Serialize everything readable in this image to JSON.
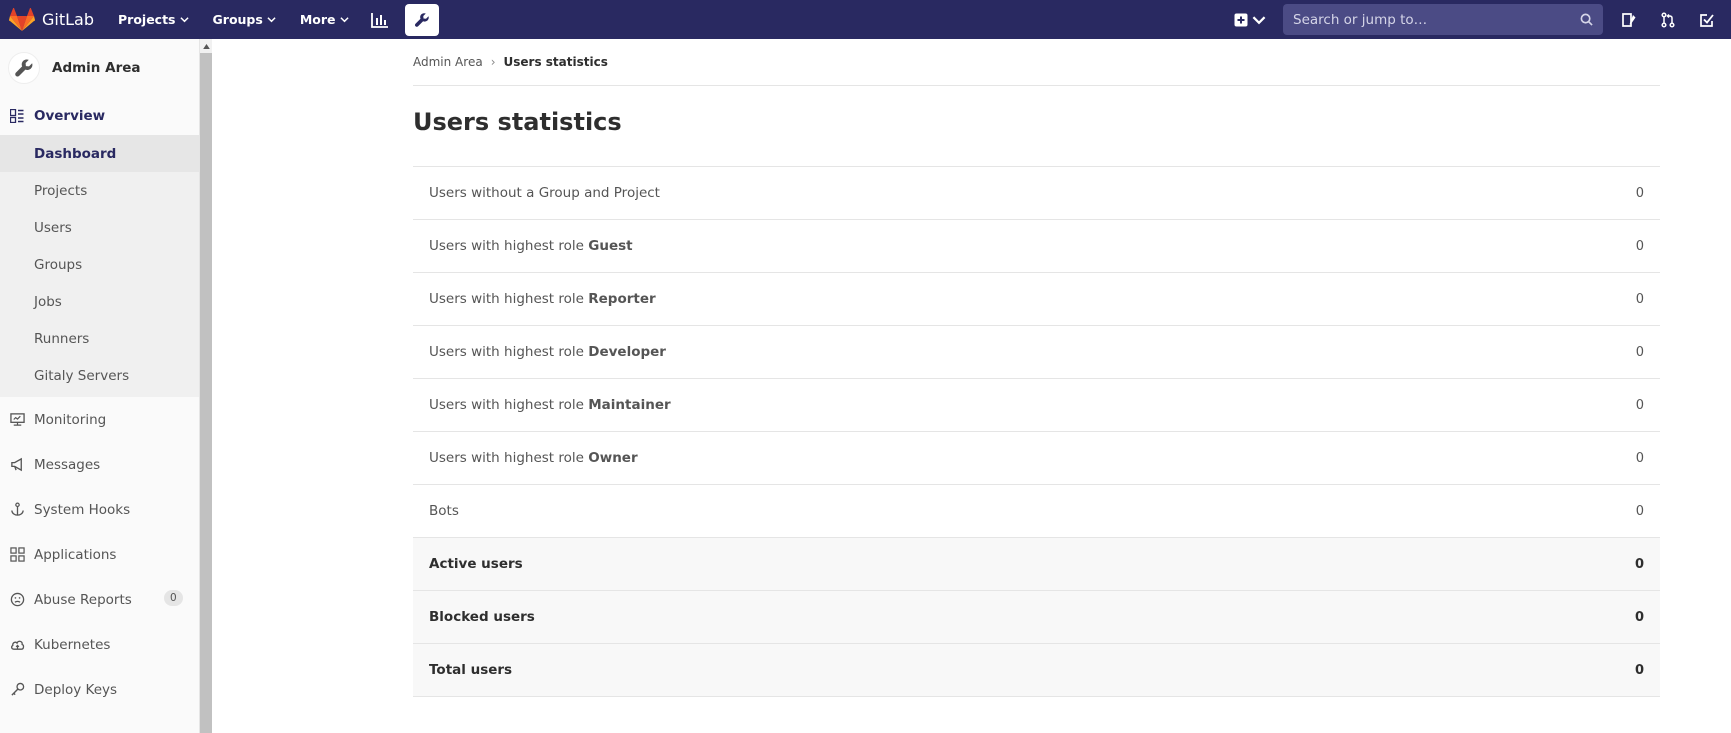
{
  "navbar": {
    "logo_text": "GitLab",
    "menu": [
      {
        "label": "Projects"
      },
      {
        "label": "Groups"
      },
      {
        "label": "More"
      }
    ],
    "search_placeholder": "Search or jump to…",
    "brand_color": "#292961"
  },
  "sidebar": {
    "title": "Admin Area",
    "overview": {
      "label": "Overview",
      "items": [
        {
          "label": "Dashboard",
          "active": true
        },
        {
          "label": "Projects"
        },
        {
          "label": "Users"
        },
        {
          "label": "Groups"
        },
        {
          "label": "Jobs"
        },
        {
          "label": "Runners"
        },
        {
          "label": "Gitaly Servers"
        }
      ]
    },
    "items": [
      {
        "label": "Monitoring",
        "icon": "monitor-icon"
      },
      {
        "label": "Messages",
        "icon": "megaphone-icon"
      },
      {
        "label": "System Hooks",
        "icon": "anchor-icon"
      },
      {
        "label": "Applications",
        "icon": "applications-icon"
      },
      {
        "label": "Abuse Reports",
        "icon": "frown-icon",
        "badge": "0"
      },
      {
        "label": "Kubernetes",
        "icon": "cloud-icon"
      },
      {
        "label": "Deploy Keys",
        "icon": "key-icon"
      }
    ]
  },
  "breadcrumb": {
    "parent": "Admin Area",
    "current": "Users statistics"
  },
  "page": {
    "title": "Users statistics"
  },
  "stats": {
    "rows": [
      {
        "prefix": "Users without a Group and Project",
        "role": "",
        "value": "0"
      },
      {
        "prefix": "Users with highest role ",
        "role": "Guest",
        "value": "0"
      },
      {
        "prefix": "Users with highest role ",
        "role": "Reporter",
        "value": "0"
      },
      {
        "prefix": "Users with highest role ",
        "role": "Developer",
        "value": "0"
      },
      {
        "prefix": "Users with highest role ",
        "role": "Maintainer",
        "value": "0"
      },
      {
        "prefix": "Users with highest role ",
        "role": "Owner",
        "value": "0"
      },
      {
        "prefix": "Bots",
        "role": "",
        "value": "0"
      }
    ],
    "totals": [
      {
        "label": "Active users",
        "value": "0"
      },
      {
        "label": "Blocked users",
        "value": "0"
      },
      {
        "label": "Total users",
        "value": "0"
      }
    ]
  }
}
